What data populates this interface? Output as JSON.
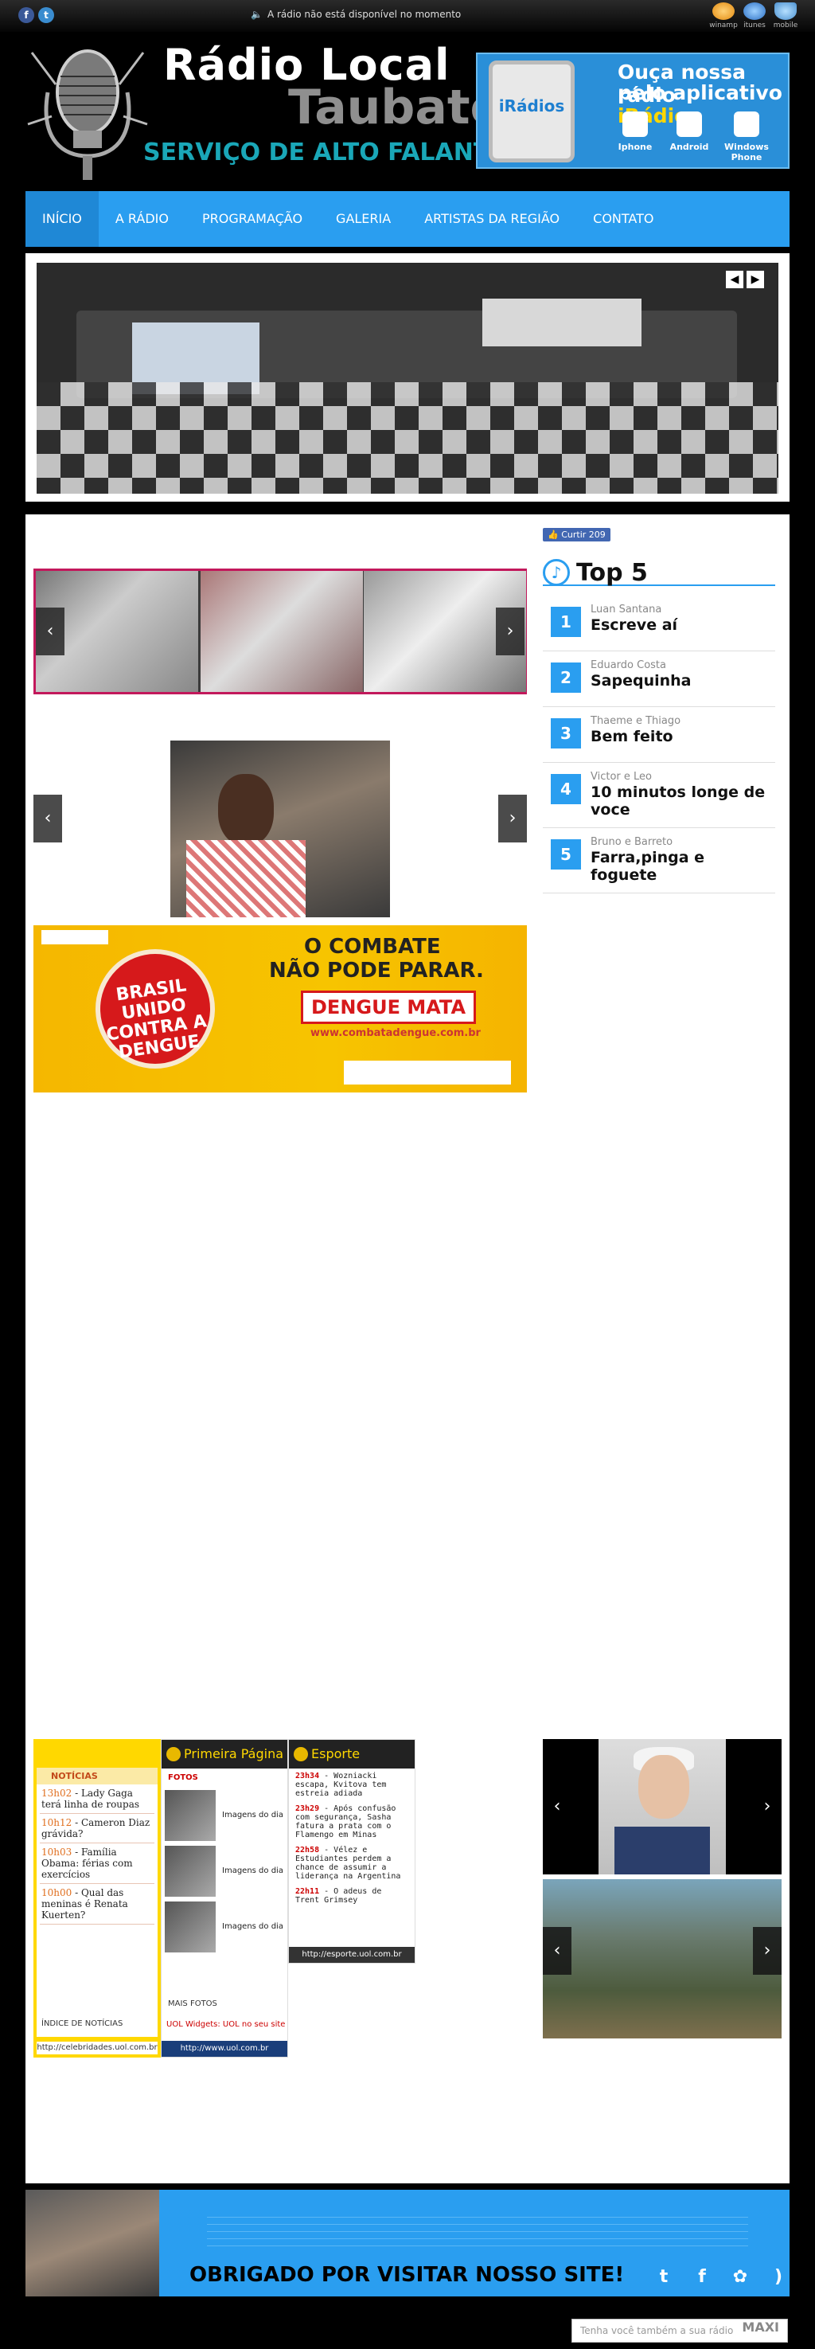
{
  "topbar": {
    "status_text": "A rádio não está disponível no momento",
    "players": [
      "winamp",
      "itunes",
      "mobile"
    ]
  },
  "header": {
    "logo_line1": "Rádio Local",
    "logo_line2": "Taubaté",
    "logo_line3": "SERVIÇO DE ALTO FALANTE",
    "iradios_brand": "iRádios",
    "iradios_line1": "Ouça nossa rádio",
    "iradios_line2_pre": "pelo aplicativo",
    "iradios_line2_brand": "iRádios",
    "platforms": [
      "Iphone",
      "Android",
      "Windows Phone"
    ]
  },
  "nav": [
    "INÍCIO",
    "A RÁDIO",
    "PROGRAMAÇÃO",
    "GALERIA",
    "ARTISTAS DA REGIÃO",
    "CONTATO"
  ],
  "like": {
    "label": "Curtir",
    "count": "209"
  },
  "top5": {
    "title": "Top 5",
    "items": [
      {
        "rank": "1",
        "artist": "Luan Santana",
        "song": "Escreve aí"
      },
      {
        "rank": "2",
        "artist": "Eduardo Costa",
        "song": "Sapequinha"
      },
      {
        "rank": "3",
        "artist": "Thaeme e Thiago",
        "song": "Bem feito"
      },
      {
        "rank": "4",
        "artist": "Victor e Leo",
        "song": "10 minutos longe de voce"
      },
      {
        "rank": "5",
        "artist": "Bruno e Barreto",
        "song": "Farra,pinga e foguete"
      }
    ]
  },
  "dengue": {
    "seal": "BRASIL UNIDO CONTRA A DENGUE",
    "h1": "O COMBATE",
    "h2": "NÃO PODE PARAR.",
    "mata": "DENGUE MATA",
    "url": "www.combatadengue.com.br"
  },
  "uol_celebridades": {
    "section": "NOTÍCIAS",
    "items": [
      {
        "time": "13h02",
        "text": "Lady Gaga terá linha de roupas"
      },
      {
        "time": "10h12",
        "text": "Cameron Diaz grávida?"
      },
      {
        "time": "10h03",
        "text": "Família Obama: férias com exercícios"
      },
      {
        "time": "10h00",
        "text": "Qual das meninas é Renata Kuerten?"
      }
    ],
    "index": "ÍNDICE DE NOTÍCIAS",
    "footer": "http://celebridades.uol.com.br"
  },
  "uol_primeira": {
    "title": "Primeira Página",
    "fotos": "FOTOS",
    "photos": [
      "Imagens do dia",
      "Imagens do dia",
      "Imagens do dia"
    ],
    "mais": "MAIS FOTOS",
    "widgets": "UOL Widgets: UOL no seu site",
    "footer": "http://www.uol.com.br"
  },
  "uol_esporte": {
    "title": "Esporte",
    "items": [
      {
        "time": "23h34",
        "text": "Wozniacki escapa, Kvitova tem estreia adiada"
      },
      {
        "time": "23h29",
        "text": "Após confusão com segurança, Sasha fatura a prata com o Flamengo em Minas"
      },
      {
        "time": "22h58",
        "text": "Vélez e Estudiantes perdem a chance de assumir a liderança na Argentina"
      },
      {
        "time": "22h11",
        "text": "O adeus de Trent Grimsey"
      }
    ],
    "footer": "http://esporte.uol.com.br"
  },
  "footer": {
    "thanks": "OBRIGADO POR VISITAR NOSSO SITE!"
  },
  "banner": {
    "text": "Tenha você também a sua rádio",
    "brand": "MAXI"
  }
}
